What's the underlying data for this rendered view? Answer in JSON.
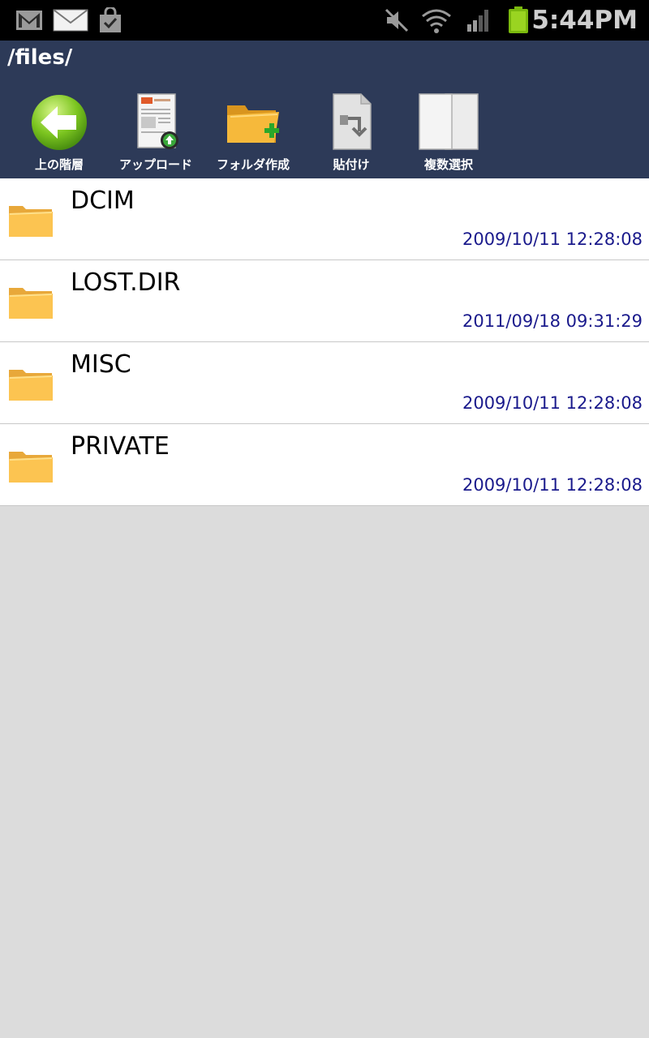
{
  "status_bar": {
    "time": "5:44PM",
    "icons": [
      "gmail-icon",
      "email-icon",
      "market-update-icon",
      "mute-icon",
      "wifi-icon",
      "signal-icon",
      "battery-icon"
    ]
  },
  "header": {
    "path": "/files/"
  },
  "toolbar": {
    "up_label": "上の階層",
    "upload_label": "アップロード",
    "new_folder_label": "フォルダ作成",
    "paste_label": "貼付け",
    "multi_select_label": "複数選択"
  },
  "files": [
    {
      "name": "DCIM",
      "date": "2009/10/11 12:28:08"
    },
    {
      "name": "LOST.DIR",
      "date": "2011/09/18 09:31:29"
    },
    {
      "name": "MISC",
      "date": "2009/10/11 12:28:08"
    },
    {
      "name": "PRIVATE",
      "date": "2009/10/11 12:28:08"
    }
  ],
  "colors": {
    "header_bg": "#2d3a58",
    "date_text": "#1a1a8c",
    "folder": "#f6b93b"
  }
}
